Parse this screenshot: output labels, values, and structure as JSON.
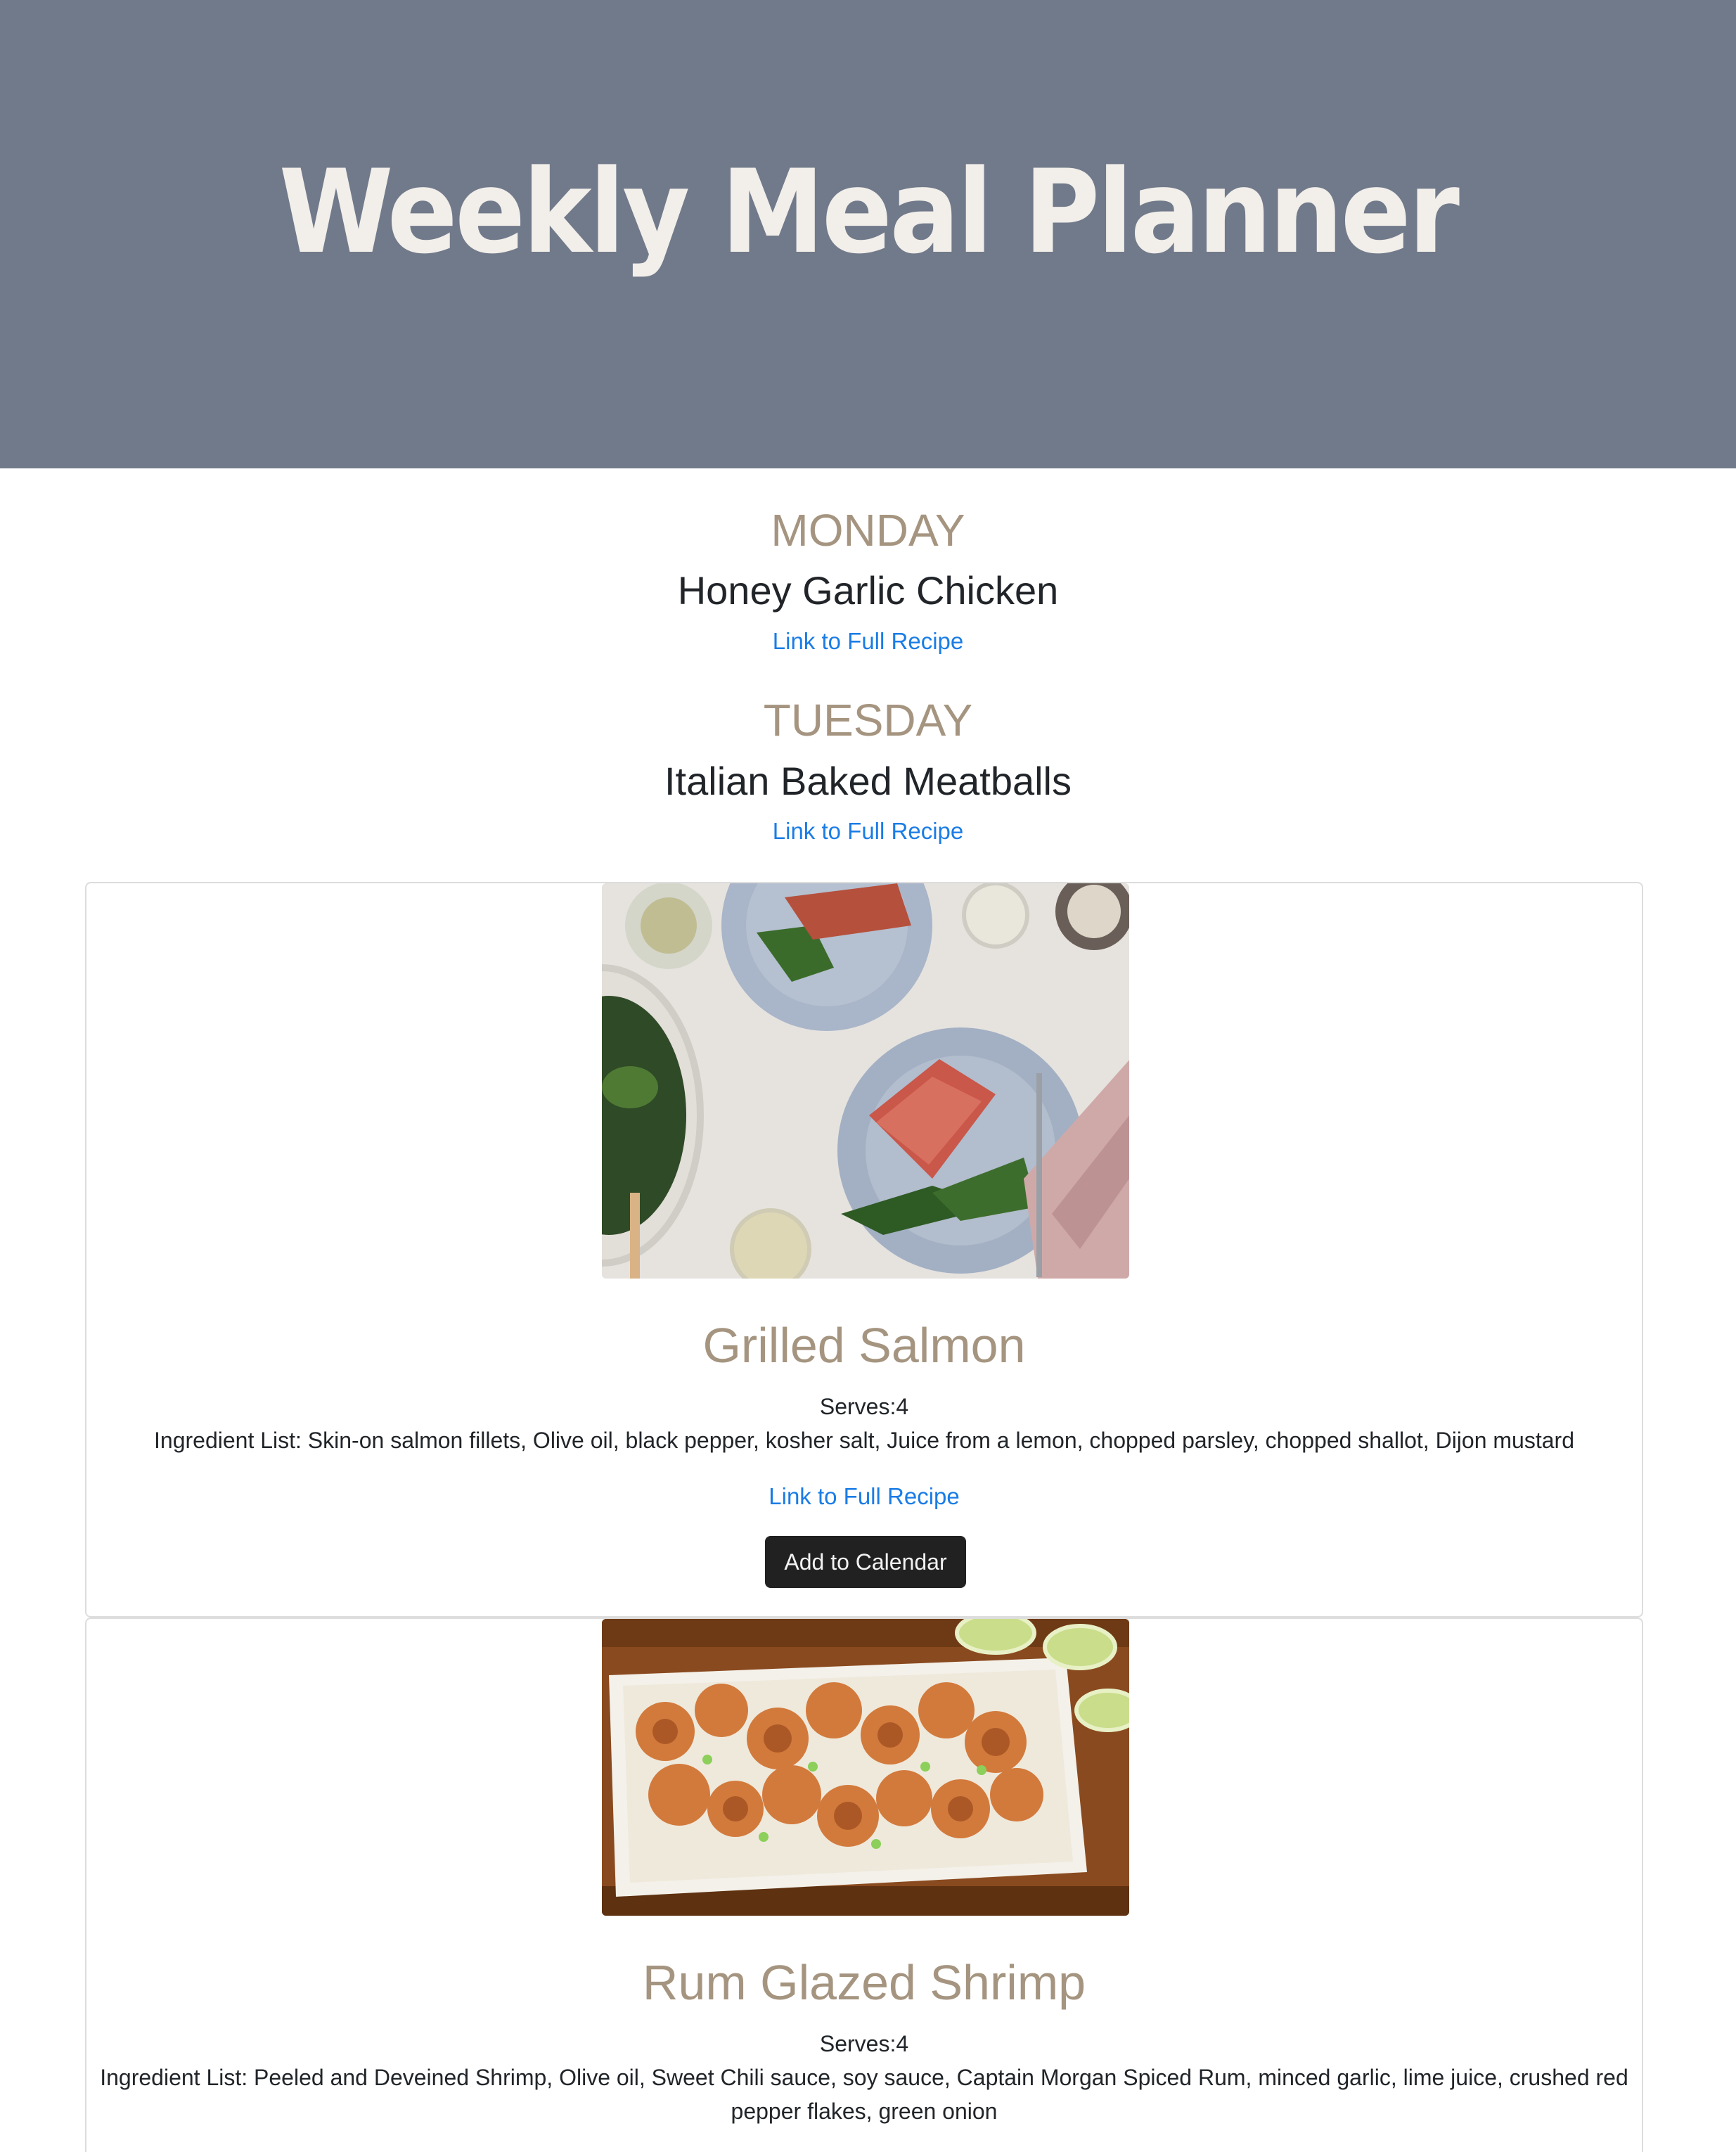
{
  "header": {
    "title": "Weekly Meal Planner"
  },
  "days": [
    {
      "day": "MONDAY",
      "meal": "Honey Garlic Chicken",
      "link": "Link to Full Recipe"
    },
    {
      "day": "TUESDAY",
      "meal": "Italian Baked Meatballs",
      "link": "Link to Full Recipe"
    }
  ],
  "cards": [
    {
      "title": "Grilled Salmon",
      "serves": "Serves:4",
      "ingredients": "Ingredient List: Skin-on salmon fillets, Olive oil, black pepper, kosher salt, Juice from a lemon, chopped parsley, chopped shallot, Dijon mustard",
      "link": "Link to Full Recipe",
      "button": "Add to Calendar"
    },
    {
      "title": "Rum Glazed Shrimp",
      "serves": "Serves:4",
      "ingredients": "Ingredient List: Peeled and Deveined Shrimp, Olive oil, Sweet Chili sauce, soy sauce, Captain Morgan Spiced Rum, minced garlic, lime juice, crushed red pepper flakes, green onion"
    }
  ]
}
